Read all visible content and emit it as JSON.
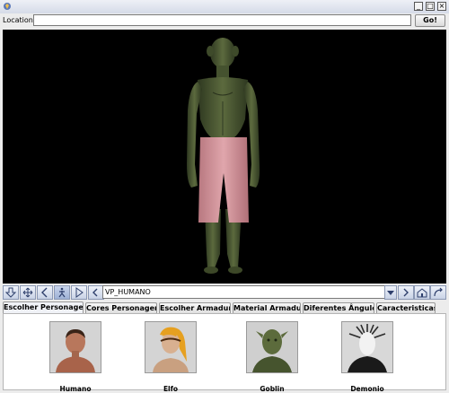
{
  "location": {
    "label": "Location:",
    "value": "",
    "go_label": "Go!"
  },
  "viewpoint": {
    "selected": "VP_HUMANO"
  },
  "tabs": [
    {
      "label": "Escolher Personagem",
      "selected": true
    },
    {
      "label": "Cores Personagem",
      "selected": false
    },
    {
      "label": "Escolher Armadura",
      "selected": false
    },
    {
      "label": "Material Armadura",
      "selected": false
    },
    {
      "label": "Diferentes Ângulos",
      "selected": false
    },
    {
      "label": "Caracteristicas",
      "selected": false
    }
  ],
  "characters": [
    {
      "name": "Humano"
    },
    {
      "name": "Elfo"
    },
    {
      "name": "Goblin"
    },
    {
      "name": "Demonio"
    }
  ],
  "colors": {
    "viewport_bg": "#000000",
    "goblin_skin": "#4c5a32",
    "shorts": "#d99aa0"
  },
  "icons": [
    "app-icon",
    "minimize-icon",
    "maximize-icon",
    "close-icon",
    "move-down-icon",
    "pan-icon",
    "turn-left-icon",
    "walk-icon",
    "play-icon",
    "previous-viewpoint-icon",
    "next-viewpoint-icon",
    "home-icon",
    "straighten-icon"
  ]
}
